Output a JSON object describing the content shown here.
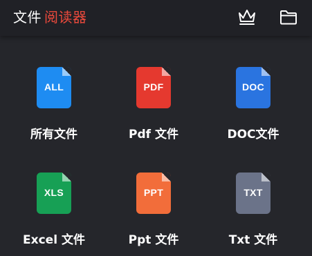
{
  "header": {
    "title_main": "文件",
    "title_accent": "阅读器",
    "accent_color": "#ec4a3c",
    "actions": [
      {
        "name": "crown-icon",
        "icon": "crown"
      },
      {
        "name": "folder-icon",
        "icon": "folder"
      }
    ]
  },
  "file_types": [
    {
      "ext": "ALL",
      "label": "所有文件",
      "color": "#1e8cf2"
    },
    {
      "ext": "PDF",
      "label": "Pdf 文件",
      "color": "#e5392f"
    },
    {
      "ext": "DOC",
      "label": "DOC文件",
      "color": "#2a74e0"
    },
    {
      "ext": "XLS",
      "label": "Excel 文件",
      "color": "#17a055"
    },
    {
      "ext": "PPT",
      "label": "Ppt 文件",
      "color": "#f26d3a"
    },
    {
      "ext": "TXT",
      "label": "Txt 文件",
      "color": "#6b7389"
    }
  ]
}
